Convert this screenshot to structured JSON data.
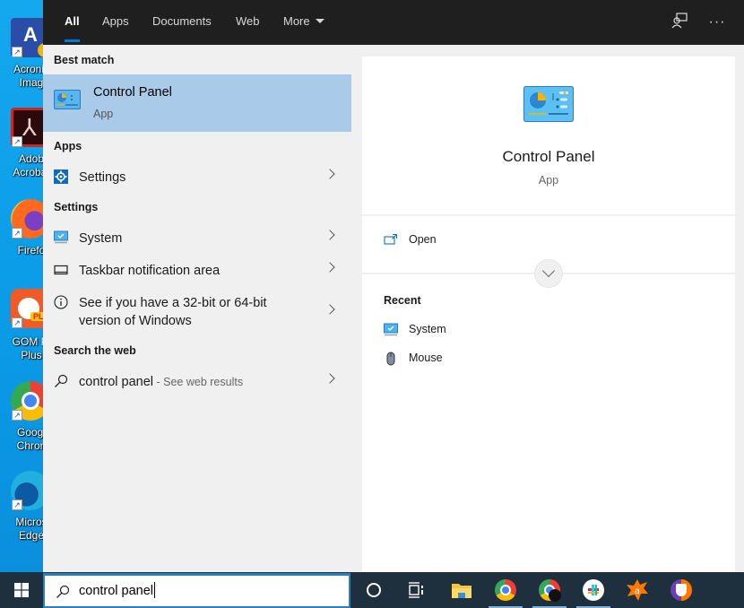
{
  "desktop": {
    "icons": [
      {
        "label_line1": "Acronis",
        "label_line2": "Imag",
        "icon": "acronis-icon"
      },
      {
        "label_line1": "Adob",
        "label_line2": "Acrobat",
        "icon": "acrobat-icon"
      },
      {
        "label_line1": "Firefo",
        "label_line2": "",
        "icon": "firefox-icon"
      },
      {
        "label_line1": "GOM Pl",
        "label_line2": "Plus",
        "icon": "gom-player-icon"
      },
      {
        "label_line1": "Googl",
        "label_line2": "Chron",
        "icon": "chrome-icon"
      },
      {
        "label_line1": "Micros",
        "label_line2": "Edge",
        "icon": "edge-icon"
      }
    ]
  },
  "search": {
    "tabs": [
      {
        "label": "All",
        "active": true
      },
      {
        "label": "Apps",
        "active": false
      },
      {
        "label": "Documents",
        "active": false
      },
      {
        "label": "Web",
        "active": false
      },
      {
        "label": "More",
        "active": false
      }
    ],
    "feedback_icon": "feedback-icon",
    "more_options_icon": "ellipsis-icon",
    "more_options_glyph": "···",
    "sections": {
      "best_match": "Best match",
      "apps": "Apps",
      "settings": "Settings",
      "search_web": "Search the web"
    },
    "best_match": {
      "title": "Control Panel",
      "subtitle": "App"
    },
    "apps": [
      {
        "label": "Settings",
        "icon": "gear-icon"
      }
    ],
    "settings": [
      {
        "label": "System",
        "icon": "monitor-icon"
      },
      {
        "label": "Taskbar notification area",
        "icon": "taskbar-icon"
      },
      {
        "label_line1": "See if you have a 32-bit or 64-bit",
        "label_line2": "version of Windows",
        "icon": "info-icon"
      }
    ],
    "web": {
      "query": "control panel",
      "separator": " - ",
      "hint": "See web results"
    },
    "preview": {
      "title": "Control Panel",
      "subtitle": "App",
      "actions": [
        {
          "label": "Open",
          "icon": "open-icon"
        }
      ],
      "recent_header": "Recent",
      "recent": [
        {
          "label": "System",
          "icon": "monitor-icon"
        },
        {
          "label": "Mouse",
          "icon": "mouse-icon"
        }
      ]
    },
    "input_value": "control panel"
  },
  "taskbar": {
    "apps": [
      "cortana",
      "task-view",
      "file-explorer",
      "chrome",
      "chrome-profile",
      "slack",
      "avast",
      "avast-secure-browser"
    ]
  },
  "colors": {
    "accent": "#0078d7",
    "selection": "#a9cbe9",
    "taskbar": "#1e2f3e",
    "topbar": "#1f1f1f"
  }
}
